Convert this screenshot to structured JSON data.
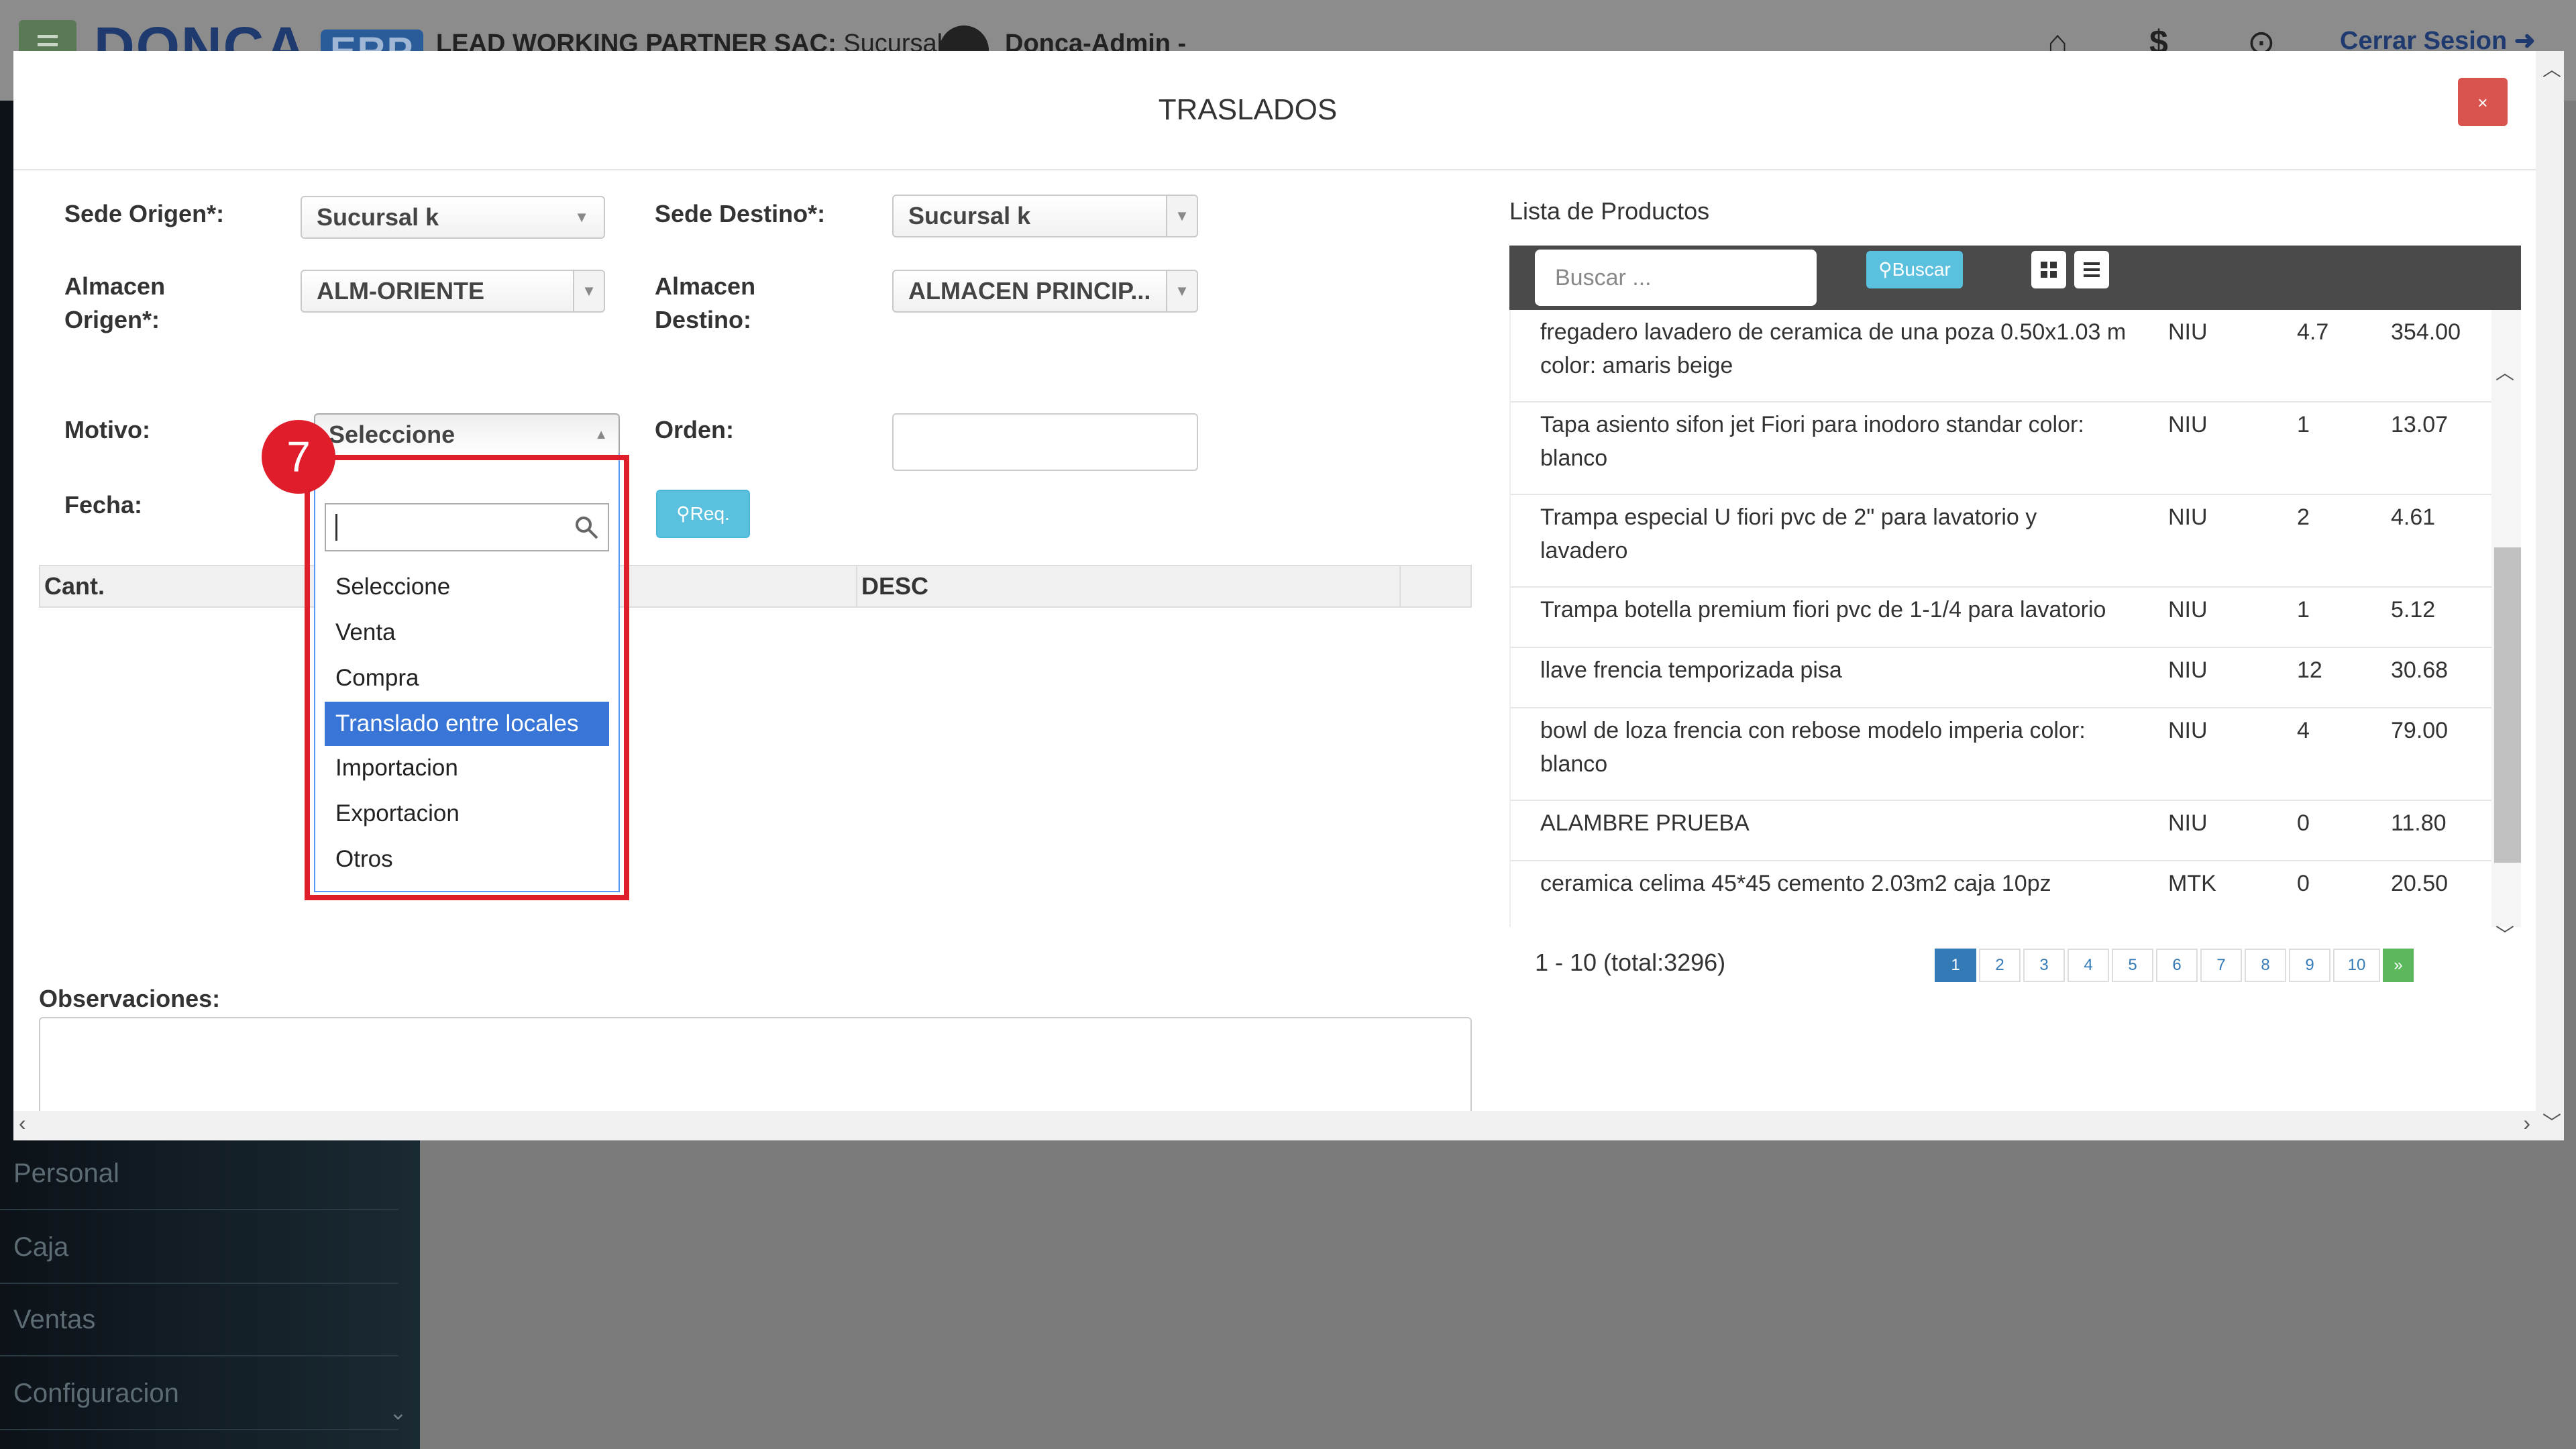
{
  "topbar": {
    "logo_text": "DONCA",
    "logo_badge": "ERP",
    "company": "LEAD WORKING PARTNER SAC:",
    "branch": "Sucursal k |",
    "user": "Donca-Admin -",
    "logout": "Cerrar Sesion"
  },
  "sidebar": {
    "items": [
      "Personal",
      "Caja",
      "Ventas",
      "Configuracion"
    ]
  },
  "modal": {
    "title": "TRASLADOS",
    "close": "×"
  },
  "form": {
    "sede_origen_label": "Sede Origen*:",
    "sede_origen_value": "Sucursal k",
    "sede_destino_label": "Sede Destino*:",
    "sede_destino_value": "Sucursal k",
    "almacen_origen_label_1": "Almacen",
    "almacen_origen_label_2": "Origen*:",
    "almacen_origen_value": "ALM-ORIENTE",
    "almacen_destino_label_1": "Almacen",
    "almacen_destino_label_2": "Destino:",
    "almacen_destino_value": "ALMACEN PRINCIP...",
    "motivo_label": "Motivo:",
    "motivo_value": "Seleccione",
    "orden_label": "Orden:",
    "fecha_label": "Fecha:",
    "req_button": "Req.",
    "table_headers": [
      "Cant.",
      "DESC"
    ],
    "observaciones_label": "Observaciones:"
  },
  "dropdown": {
    "options": [
      "Seleccione",
      "Venta",
      "Compra",
      "Translado entre locales",
      "Importacion",
      "Exportacion",
      "Otros"
    ],
    "active_index": 3
  },
  "annotation": {
    "step": "7"
  },
  "products": {
    "title": "Lista de Productos",
    "search_placeholder": "Buscar ...",
    "search_button": "Buscar",
    "rows": [
      {
        "name": "fregadero lavadero de ceramica de una poza 0.50x1.03 m color: amaris beige",
        "unit": "NIU",
        "qty": "4.7",
        "price": "354.00"
      },
      {
        "name": "Tapa asiento sifon jet Fiori para inodoro standar color: blanco",
        "unit": "NIU",
        "qty": "1",
        "price": "13.07"
      },
      {
        "name": "Trampa especial U fiori pvc de 2\" para lavatorio y lavadero",
        "unit": "NIU",
        "qty": "2",
        "price": "4.61"
      },
      {
        "name": "Trampa botella premium fiori pvc de 1-1/4 para lavatorio",
        "unit": "NIU",
        "qty": "1",
        "price": "5.12"
      },
      {
        "name": "llave frencia temporizada pisa",
        "unit": "NIU",
        "qty": "12",
        "price": "30.68"
      },
      {
        "name": "bowl de loza frencia con rebose modelo imperia color: blanco",
        "unit": "NIU",
        "qty": "4",
        "price": "79.00"
      },
      {
        "name": "ALAMBRE PRUEBA",
        "unit": "NIU",
        "qty": "0",
        "price": "11.80"
      },
      {
        "name": "ceramica celima 45*45 cemento 2.03m2 caja 10pz",
        "unit": "MTK",
        "qty": "0",
        "price": "20.50"
      }
    ],
    "paging_info": "1 - 10 (total:3296)",
    "pages": [
      "1",
      "2",
      "3",
      "4",
      "5",
      "6",
      "7",
      "8",
      "9",
      "10",
      "»"
    ],
    "active_page": "1"
  },
  "colors": {
    "accent": "#3875d7",
    "danger": "#d9534f",
    "info": "#5bc0de",
    "highlight": "#e01e2b"
  }
}
